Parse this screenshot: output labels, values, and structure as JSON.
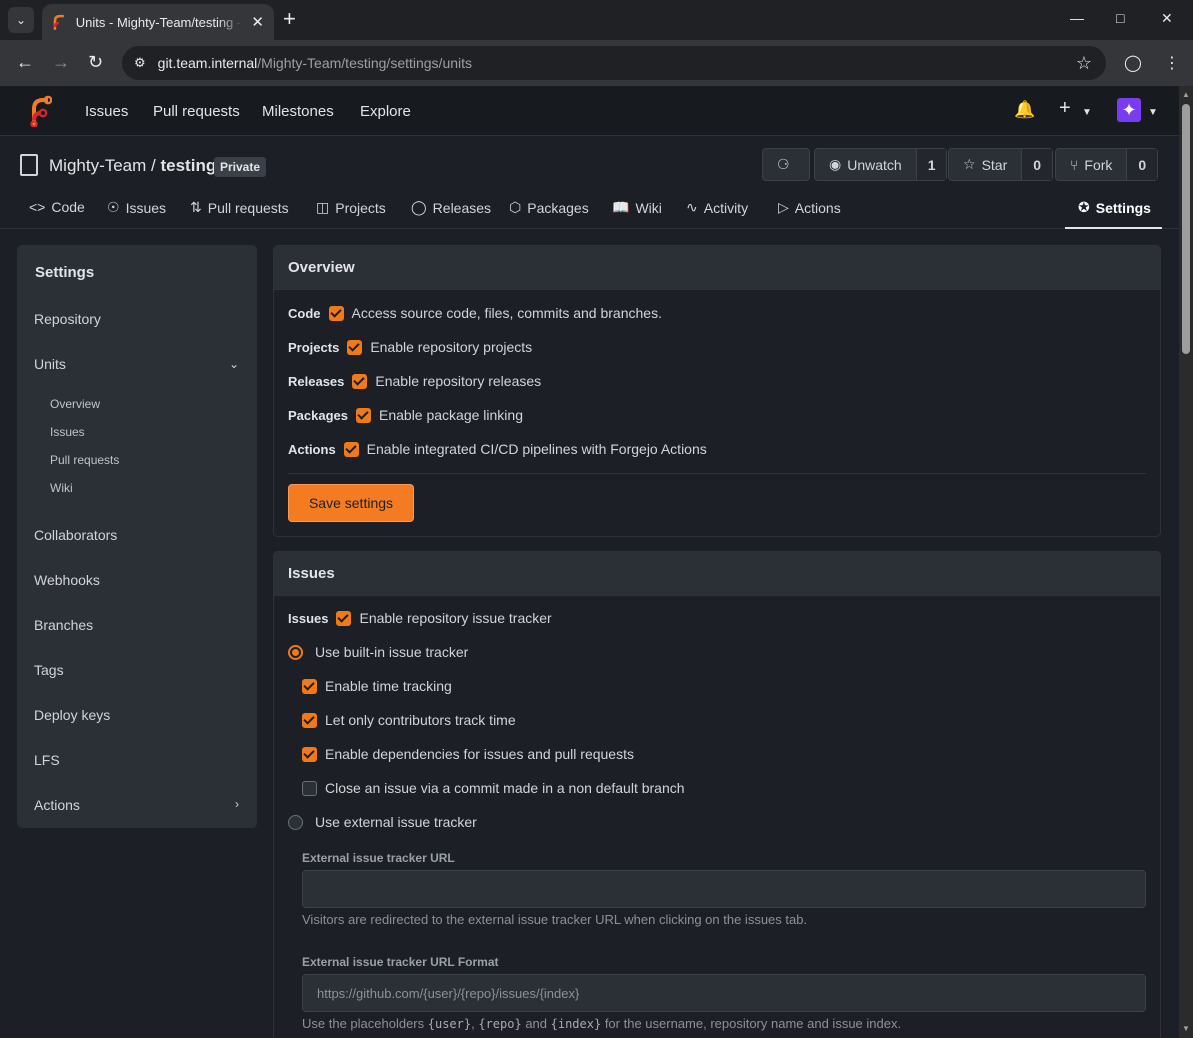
{
  "browser": {
    "tab_title": "Units - Mighty-Team/testing - Forgejo",
    "url_host": "git.team.internal",
    "url_path": "/Mighty-Team/testing/settings/units"
  },
  "navbar": {
    "items": [
      "Issues",
      "Pull requests",
      "Milestones",
      "Explore"
    ]
  },
  "repo": {
    "owner": "Mighty-Team",
    "separator": " / ",
    "name": "testing",
    "badge": "Private",
    "unwatch_label": "Unwatch",
    "watch_count": "1",
    "star_label": "Star",
    "star_count": "0",
    "fork_label": "Fork",
    "fork_count": "0",
    "tabs": [
      "Code",
      "Issues",
      "Pull requests",
      "Projects",
      "Releases",
      "Packages",
      "Wiki",
      "Activity",
      "Actions",
      "Settings"
    ]
  },
  "sidebar": {
    "title": "Settings",
    "items": [
      "Repository",
      "Units",
      "Collaborators",
      "Webhooks",
      "Branches",
      "Tags",
      "Deploy keys",
      "LFS",
      "Actions"
    ],
    "units_sub": [
      "Overview",
      "Issues",
      "Pull requests",
      "Wiki"
    ]
  },
  "overview": {
    "title": "Overview",
    "rows": [
      {
        "key": "Code",
        "label": "Access source code, files, commits and branches."
      },
      {
        "key": "Projects",
        "label": "Enable repository projects"
      },
      {
        "key": "Releases",
        "label": "Enable repository releases"
      },
      {
        "key": "Packages",
        "label": "Enable package linking"
      },
      {
        "key": "Actions",
        "label": "Enable integrated CI/CD pipelines with Forgejo Actions"
      }
    ],
    "save_label": "Save settings"
  },
  "issues": {
    "title": "Issues",
    "key": "Issues",
    "enable_label": "Enable repository issue tracker",
    "builtin_label": "Use built-in issue tracker",
    "time_tracking": "Enable time tracking",
    "contributors_time": "Let only contributors track time",
    "dependencies": "Enable dependencies for issues and pull requests",
    "close_non_default": "Close an issue via a commit made in a non default branch",
    "external_label": "Use external issue tracker",
    "ext_url_label": "External issue tracker URL",
    "ext_url_value": "",
    "ext_url_help": "Visitors are redirected to the external issue tracker URL when clicking on the issues tab.",
    "ext_format_label": "External issue tracker URL Format",
    "ext_format_placeholder": "https://github.com/{user}/{repo}/issues/{index}",
    "help2_a": "Use the placeholders ",
    "help2_user": "{user}",
    "help2_b": ", ",
    "help2_repo": "{repo}",
    "help2_c": " and ",
    "help2_index": "{index}",
    "help2_d": " for the username, repository name and issue index."
  },
  "colors": {
    "accent": "#f37c22",
    "background": "#1c1f25",
    "surface": "#2b2f36"
  }
}
